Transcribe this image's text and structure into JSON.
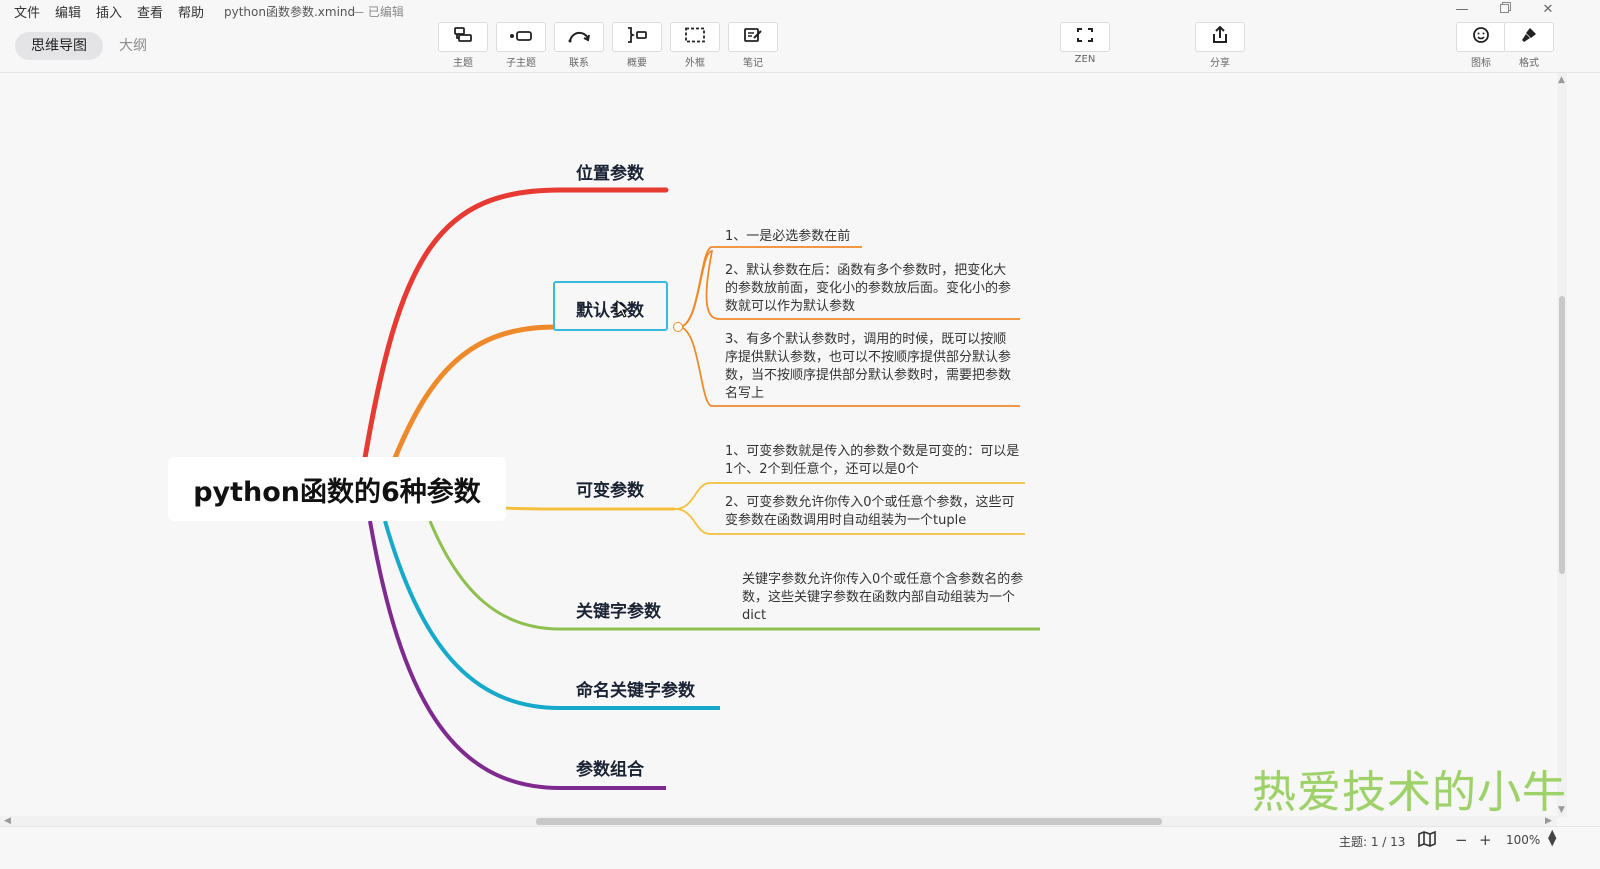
{
  "menu": {
    "items": [
      "文件",
      "编辑",
      "插入",
      "查看",
      "帮助"
    ],
    "document_title": "python函数参数.xmind",
    "document_status": "— 已编辑"
  },
  "view_switch": {
    "mindmap_tab": "思维导图",
    "outline_tab": "大纲"
  },
  "toolbar": {
    "topic": "主题",
    "subtopic": "子主题",
    "relationship": "联系",
    "summary": "概要",
    "boundary": "外框",
    "note": "笔记",
    "zen": "ZEN",
    "share": "分享",
    "icon": "图标",
    "format": "格式"
  },
  "mindmap": {
    "central_topic": "python函数的6种参数",
    "branches": [
      {
        "label": "位置参数",
        "color": "#e63a33",
        "notes": []
      },
      {
        "label": "默认参数",
        "color": "#ef8a2b",
        "selected": true,
        "notes": [
          "1、一是必选参数在前",
          "2、默认参数在后：函数有多个参数时，把变化大的参数放前面，变化小的参数放后面。变化小的参数就可以作为默认参数",
          "3、有多个默认参数时，调用的时候，既可以按顺序提供默认参数，也可以不按顺序提供部分默认参数，当不按顺序提供部分默认参数时，需要把参数名写上"
        ]
      },
      {
        "label": "可变参数",
        "color": "#f4bf3c",
        "notes": [
          "1、可变参数就是传入的参数个数是可变的：可以是1个、2个到任意个，还可以是0个",
          "2、可变参数允许你传入0个或任意个参数，这些可变参数在函数调用时自动组装为一个tuple"
        ]
      },
      {
        "label": "关键字参数",
        "color": "#8ec04f",
        "notes": [
          "关键字参数允许你传入0个或任意个含参数名的参数，这些关键字参数在函数内部自动组装为一个dict"
        ]
      },
      {
        "label": "命名关键字参数",
        "color": "#17a9c9",
        "notes": []
      },
      {
        "label": "参数组合",
        "color": "#7f2a8e",
        "notes": []
      }
    ]
  },
  "watermark": "热爱技术的小牛",
  "statusbar": {
    "topic_count": "主题: 1 / 13",
    "zoom": "100%"
  }
}
